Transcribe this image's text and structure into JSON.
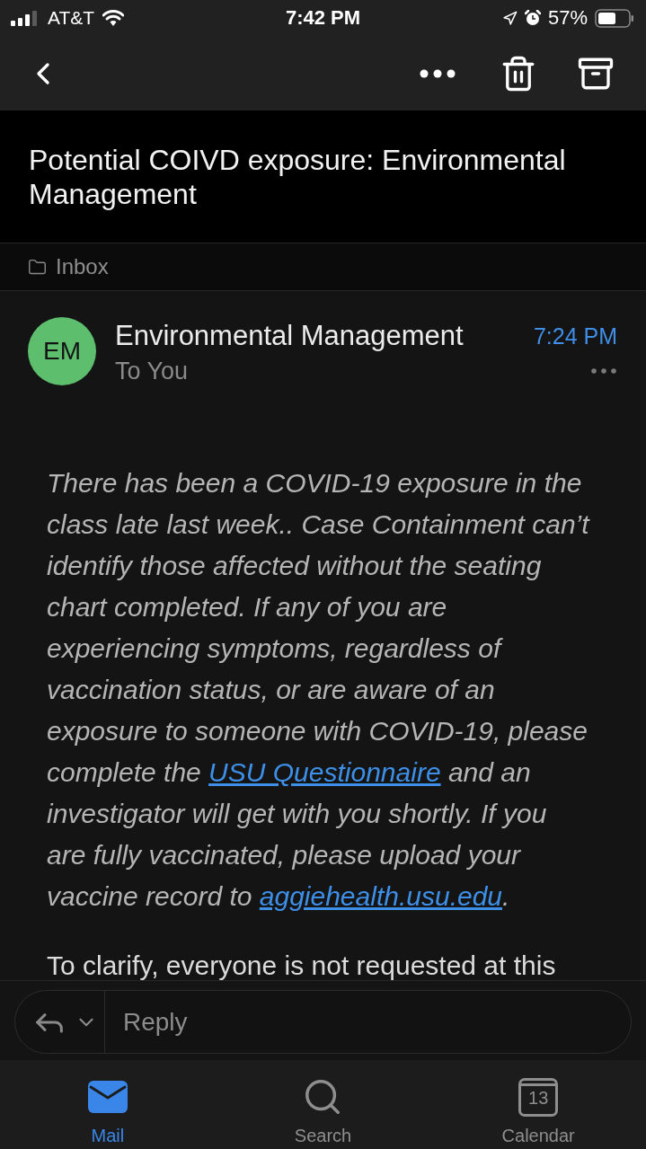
{
  "status_bar": {
    "carrier": "AT&T",
    "time": "7:42 PM",
    "battery": "57%"
  },
  "subject": "Potential COIVD exposure: Environmental Management",
  "folder": {
    "label": "Inbox"
  },
  "message": {
    "avatar": "EM",
    "sender": "Environmental Management",
    "recipient": "To You",
    "time": "7:24 PM",
    "body": [
      {
        "italic": true,
        "segments": [
          {
            "kind": "text",
            "text": "There has been a COVID-19 exposure in the class late last week.. Case Containment can’t identify those affected without the seating chart completed. If any of you are experiencing symptoms, regardless of vaccination status, or are aware of an exposure to someone with COVID-19, please complete the "
          },
          {
            "kind": "link",
            "text": "USU Questionnaire"
          },
          {
            "kind": "text",
            "text": " and an investigator will get with you shortly. If you are fully vaccinated, please upload your vaccine record to "
          },
          {
            "kind": "link",
            "text": "aggiehealth.usu.edu"
          },
          {
            "kind": "text",
            "text": "."
          }
        ]
      },
      {
        "italic": false,
        "segments": [
          {
            "kind": "text",
            "text": "To clarify, everyone is not requested at this"
          }
        ]
      }
    ]
  },
  "reply": {
    "placeholder": "Reply"
  },
  "tabs": [
    {
      "kind": "mail",
      "label": "Mail",
      "selected": true
    },
    {
      "kind": "search",
      "label": "Search",
      "selected": false
    },
    {
      "kind": "calendar",
      "label": "Calendar",
      "selected": false,
      "date": "13"
    }
  ]
}
